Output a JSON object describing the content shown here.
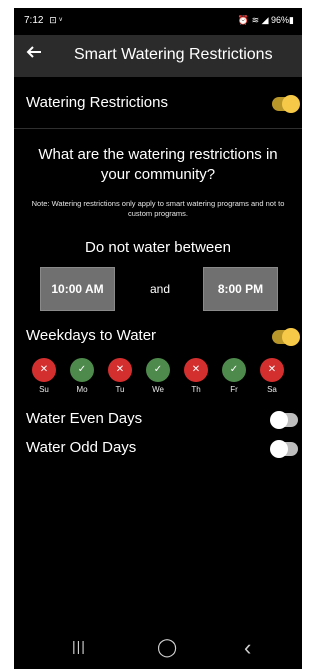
{
  "status_bar": {
    "time": "7:12",
    "left_icons": "⊡ ᵛ",
    "right_text": "⏰ ≋ ◢ 96%▮"
  },
  "app_bar": {
    "back_icon": "arrow-left-icon",
    "title": "Smart Watering Restrictions"
  },
  "restrictions_toggle": {
    "label": "Watering Restrictions",
    "on": true
  },
  "question": "What are the watering restrictions in your community?",
  "note": "Note: Watering restrictions only apply to smart watering programs and not to custom programs.",
  "do_not_water": {
    "heading": "Do not water between",
    "start_time": "10:00 AM",
    "connector": "and",
    "end_time": "8:00 PM"
  },
  "weekdays": {
    "label": "Weekdays to Water",
    "on": true,
    "days": [
      {
        "label": "Su",
        "allowed": false
      },
      {
        "label": "Mo",
        "allowed": true
      },
      {
        "label": "Tu",
        "allowed": false
      },
      {
        "label": "We",
        "allowed": true
      },
      {
        "label": "Th",
        "allowed": false
      },
      {
        "label": "Fr",
        "allowed": true
      },
      {
        "label": "Sa",
        "allowed": false
      }
    ]
  },
  "even_days": {
    "label": "Water Even Days",
    "on": false
  },
  "odd_days": {
    "label": "Water Odd Days",
    "on": false
  },
  "nav_bar": {
    "recents": "|||",
    "home": "◯",
    "back": "‹"
  },
  "colors": {
    "background": "#000000",
    "app_bar": "#2b2b2b",
    "toggle_on": "#f7c948",
    "day_allowed": "#4e8a4c",
    "day_blocked": "#d32f2f",
    "time_box": "#707070"
  }
}
